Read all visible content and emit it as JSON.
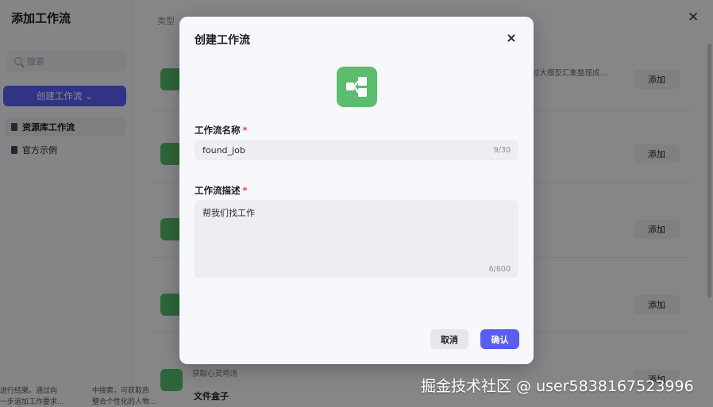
{
  "background": {
    "sidebar": {
      "title": "添加工作流",
      "search_placeholder": "搜索",
      "create_button_label": "创建工作流",
      "nav_items": [
        {
          "label": "资源库工作流",
          "active": true
        },
        {
          "label": "官方示例",
          "active": false
        }
      ]
    },
    "type_label": "类型",
    "rows": [
      {
        "snippet": "过大模型汇集整理成...",
        "add_label": "添加"
      },
      {
        "snippet": "",
        "add_label": "添加"
      },
      {
        "snippet": "",
        "add_label": "添加"
      },
      {
        "snippet": "",
        "add_label": "添加"
      },
      {
        "snippet": "获取心灵鸡汤",
        "add_label": "添加"
      }
    ],
    "file_box_label": "文件盒子",
    "bottom_left_lines": [
      "进行结果。通过向",
      "一步追加工作要求..."
    ],
    "bottom_mid_lines": [
      "中搜索，可获取热",
      "整合个性化的人物..."
    ]
  },
  "modal": {
    "title": "创建工作流",
    "name_label": "工作流名称",
    "name_value": "found_job",
    "name_counter": "9/30",
    "desc_label": "工作流描述",
    "desc_value": "帮我们找工作",
    "desc_counter": "6/600",
    "required_mark": "*",
    "cancel_label": "取消",
    "confirm_label": "确认"
  },
  "watermark": "掘金技术社区 @ user5838167523996",
  "colors": {
    "accent": "#5a5df0",
    "icon_green": "#5bbd6d",
    "required_red": "#e5484d"
  }
}
